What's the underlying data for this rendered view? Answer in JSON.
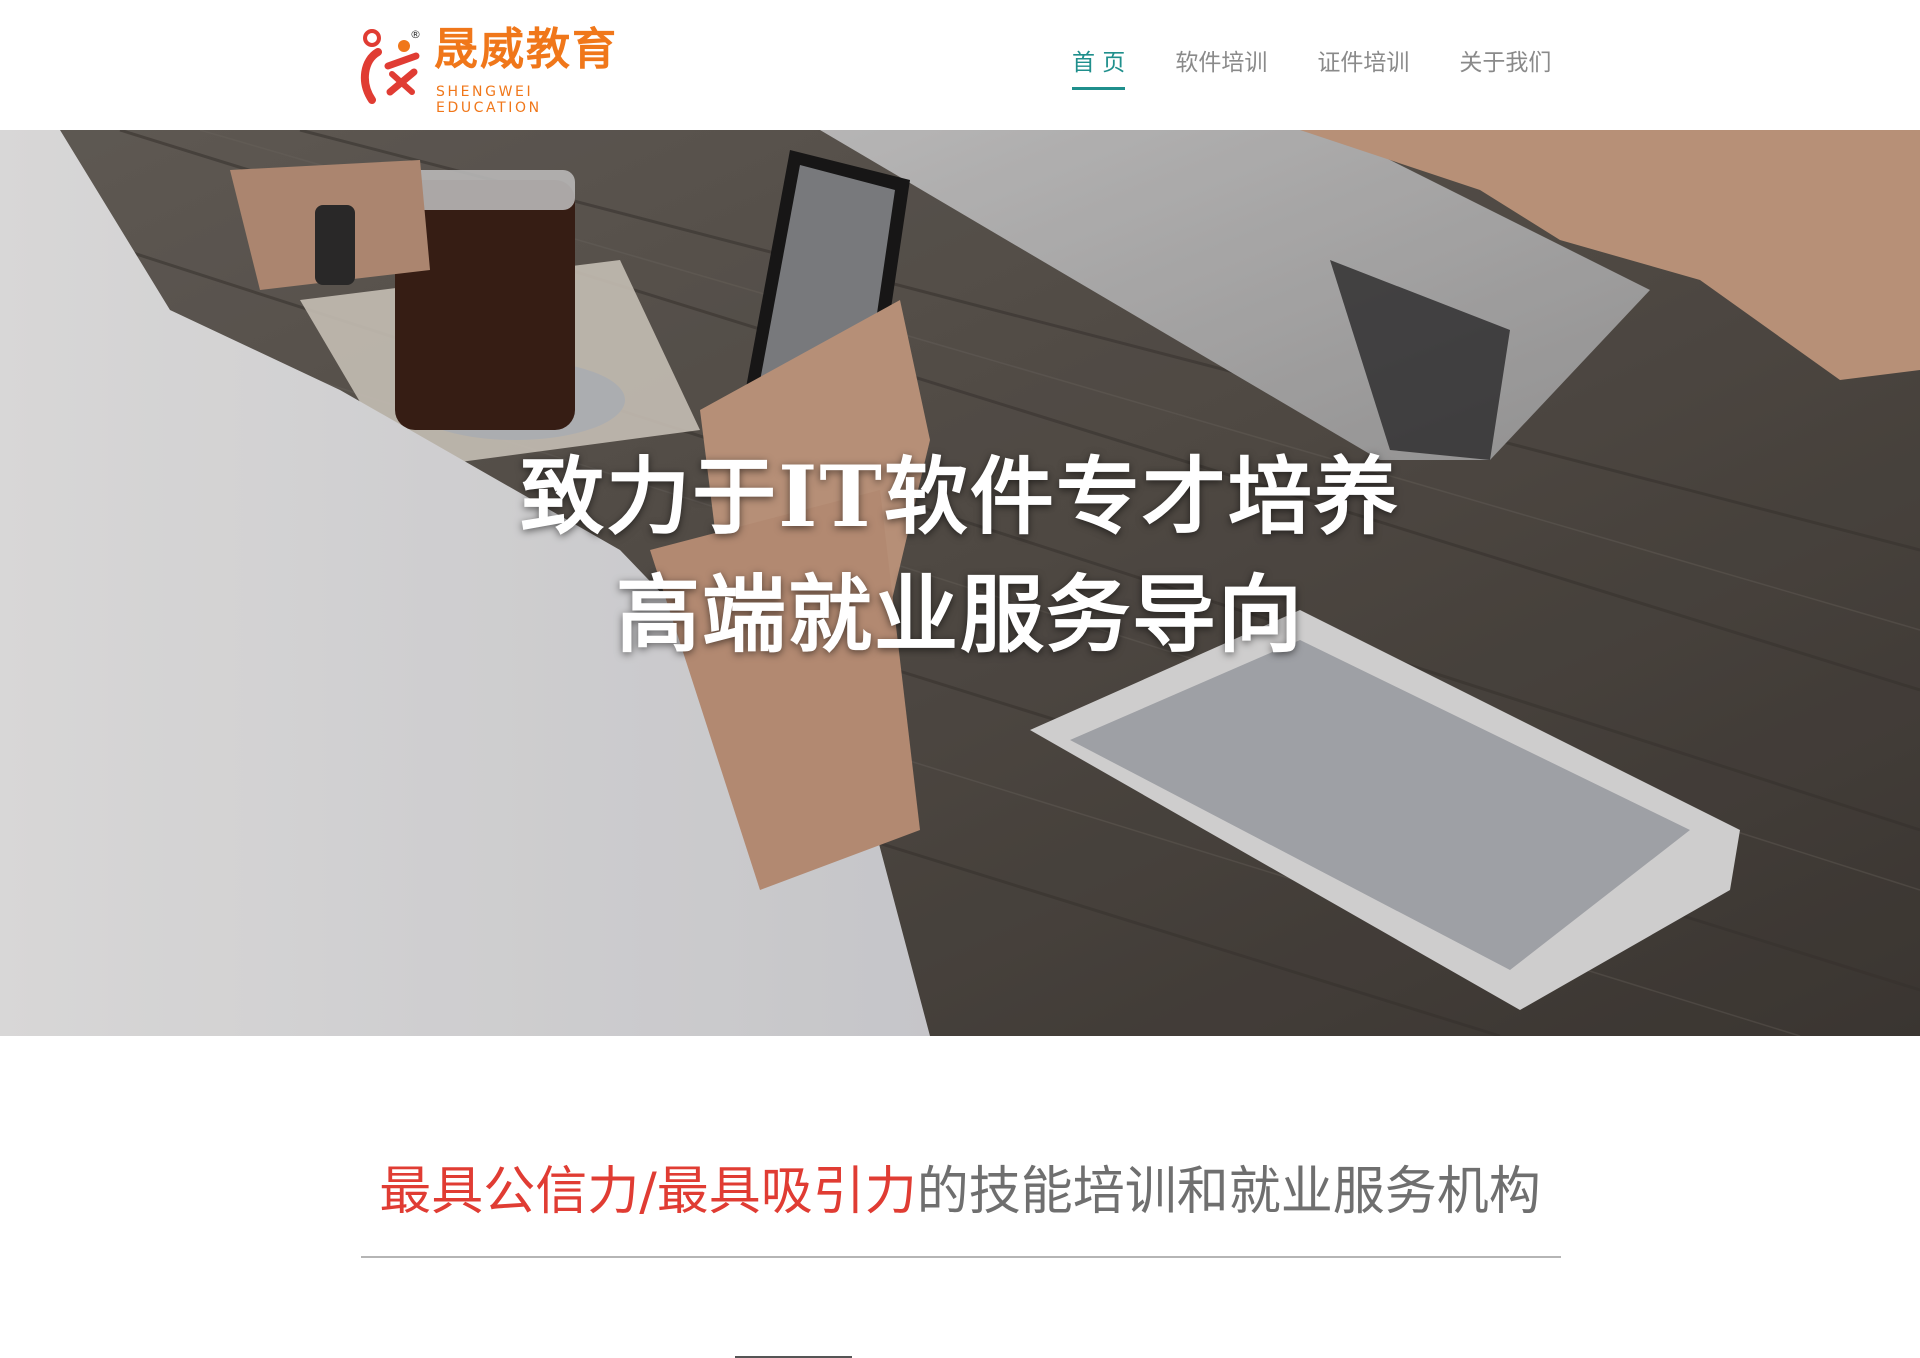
{
  "brand": {
    "name_cn": "晟威教育",
    "name_en": "SHENGWEI EDUCATION",
    "reg_mark": "®",
    "color": "#f0771a",
    "mark_color": "#e03c33"
  },
  "nav": {
    "items": [
      {
        "label": "首 页",
        "active": true
      },
      {
        "label": "软件培训",
        "active": false
      },
      {
        "label": "证件培训",
        "active": false
      },
      {
        "label": "关于我们",
        "active": false
      }
    ],
    "active_color": "#1f8f8c"
  },
  "hero": {
    "line1": "致力于IT软件专才培养",
    "line2": "高端就业服务导向"
  },
  "slogan": {
    "highlight": "最具公信力/最具吸引力",
    "rest": "的技能培训和就业服务机构",
    "highlight_color": "#e03c33"
  }
}
